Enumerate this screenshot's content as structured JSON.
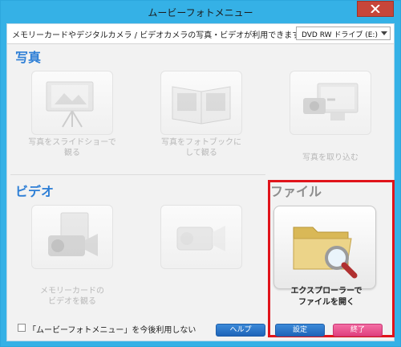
{
  "window": {
    "title": "ムービーフォトメニュー",
    "accent_color": "#35b1e6",
    "close_color": "#c7463a"
  },
  "topbar": {
    "description": "メモリーカードやデジタルカメラ / ビデオカメラの写真・ビデオが利用できます。ドライブ：",
    "drive_value": "DVD RW ドライブ (E:)"
  },
  "photo_section": {
    "title": "写真",
    "items": [
      {
        "line1": "写真をスライドショーで",
        "line2": "観る",
        "icon": "slideshow-projector-icon"
      },
      {
        "line1": "写真をフォトブックに",
        "line2": "して観る",
        "icon": "photo-book-icon"
      },
      {
        "line1": "写真を取り込む",
        "line2": "",
        "icon": "import-photo-to-pc-icon"
      }
    ]
  },
  "video_section": {
    "title": "ビデオ",
    "items": [
      {
        "line1": "メモリーカードの",
        "line2": "ビデオを観る",
        "icon": "memory-card-video-camera-icon"
      },
      {
        "line1": "",
        "line2": "",
        "icon": "video-camera-icon"
      }
    ]
  },
  "file_section": {
    "title": "ファイル",
    "item": {
      "line1": "エクスプローラーで",
      "line2": "ファイルを開く",
      "icon": "folder-magnifier-icon"
    },
    "highlight_color": "#e0141b"
  },
  "footer": {
    "checkbox_label": "「ムービーフォトメニュー」を今後利用しない",
    "help_label": "ヘルプ",
    "settings_label": "設定",
    "quit_label": "終了"
  }
}
